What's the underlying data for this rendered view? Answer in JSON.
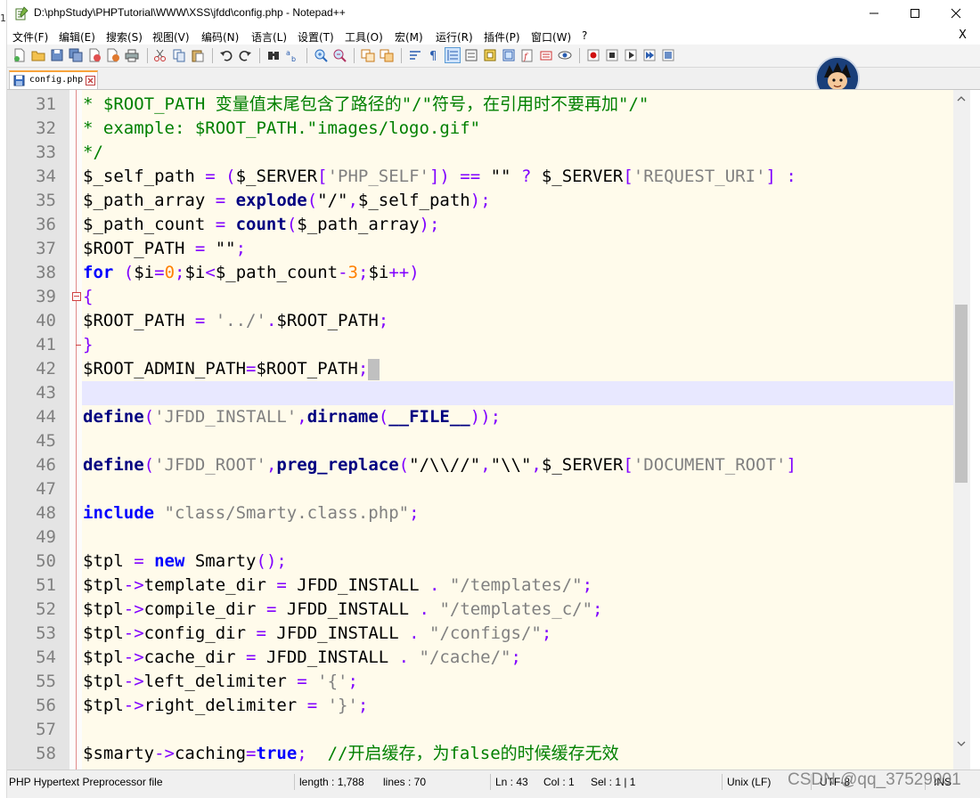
{
  "window": {
    "left_partial_text": "1",
    "title": "D:\\phpStudy\\PHPTutorial\\WWW\\XSS\\jfdd\\config.php - Notepad++",
    "controls": {
      "minimize": "minimize",
      "maximize": "maximize",
      "close": "close"
    }
  },
  "menu": {
    "items": [
      {
        "label": "文件(F)"
      },
      {
        "label": "编辑(E)"
      },
      {
        "label": "搜索(S)"
      },
      {
        "label": "视图(V)"
      },
      {
        "label": "编码(N)"
      },
      {
        "label": "语言(L)"
      },
      {
        "label": "设置(T)"
      },
      {
        "label": "工具(O)"
      },
      {
        "label": "宏(M)"
      },
      {
        "label": "运行(R)"
      },
      {
        "label": "插件(P)"
      },
      {
        "label": "窗口(W)"
      },
      {
        "label": "?"
      }
    ],
    "close_label": "X"
  },
  "tabs": [
    {
      "label": "config.php",
      "active": true
    }
  ],
  "editor": {
    "current_line": 43,
    "lines": [
      {
        "num": "31",
        "segs": [
          {
            "t": "* $ROOT_PATH 变量值末尾包含了路径的\"/\"符号，在引用时不要再加\"/\"",
            "c": "cm"
          }
        ]
      },
      {
        "num": "32",
        "segs": [
          {
            "t": "* example: $ROOT_PATH.\"images/logo.gif\"",
            "c": "cm"
          }
        ]
      },
      {
        "num": "33",
        "segs": [
          {
            "t": "*/",
            "c": "cm"
          }
        ]
      },
      {
        "num": "34",
        "segs": [
          {
            "t": "$_self_path ",
            "c": ""
          },
          {
            "t": "= (",
            "c": "op"
          },
          {
            "t": "$_SERVER",
            "c": ""
          },
          {
            "t": "[",
            "c": "op"
          },
          {
            "t": "'PHP_SELF'",
            "c": "s"
          },
          {
            "t": "]) == ",
            "c": "op"
          },
          {
            "t": "\"\"",
            "c": ""
          },
          {
            "t": " ? ",
            "c": "op"
          },
          {
            "t": "$_SERVER",
            "c": ""
          },
          {
            "t": "[",
            "c": "op"
          },
          {
            "t": "'REQUEST_URI'",
            "c": "s"
          },
          {
            "t": "] :",
            "c": "op"
          }
        ]
      },
      {
        "num": "35",
        "segs": [
          {
            "t": "$_path_array ",
            "c": ""
          },
          {
            "t": "= ",
            "c": "op"
          },
          {
            "t": "explode",
            "c": "f"
          },
          {
            "t": "(",
            "c": "op"
          },
          {
            "t": "\"/\"",
            "c": ""
          },
          {
            "t": ",",
            "c": "op"
          },
          {
            "t": "$_self_path",
            "c": ""
          },
          {
            "t": ");",
            "c": "op"
          }
        ]
      },
      {
        "num": "36",
        "segs": [
          {
            "t": "$_path_count ",
            "c": ""
          },
          {
            "t": "= ",
            "c": "op"
          },
          {
            "t": "count",
            "c": "f"
          },
          {
            "t": "(",
            "c": "op"
          },
          {
            "t": "$_path_array",
            "c": ""
          },
          {
            "t": ");",
            "c": "op"
          }
        ]
      },
      {
        "num": "37",
        "segs": [
          {
            "t": "$ROOT_PATH ",
            "c": ""
          },
          {
            "t": "= ",
            "c": "op"
          },
          {
            "t": "\"\"",
            "c": ""
          },
          {
            "t": ";",
            "c": "op"
          }
        ]
      },
      {
        "num": "38",
        "segs": [
          {
            "t": "for",
            "c": "k"
          },
          {
            "t": " (",
            "c": "op"
          },
          {
            "t": "$i",
            "c": ""
          },
          {
            "t": "=",
            "c": "op"
          },
          {
            "t": "0",
            "c": "n"
          },
          {
            "t": ";",
            "c": "op"
          },
          {
            "t": "$i",
            "c": ""
          },
          {
            "t": "<",
            "c": "op"
          },
          {
            "t": "$_path_count",
            "c": ""
          },
          {
            "t": "-",
            "c": "op"
          },
          {
            "t": "3",
            "c": "n"
          },
          {
            "t": ";",
            "c": "op"
          },
          {
            "t": "$i",
            "c": ""
          },
          {
            "t": "++)",
            "c": "op"
          }
        ]
      },
      {
        "num": "39",
        "fold": "box",
        "segs": [
          {
            "t": "{",
            "c": "op"
          }
        ]
      },
      {
        "num": "40",
        "fold": "mid",
        "segs": [
          {
            "t": "$ROOT_PATH ",
            "c": ""
          },
          {
            "t": "= ",
            "c": "op"
          },
          {
            "t": "'../'",
            "c": "s"
          },
          {
            "t": ".",
            "c": "op"
          },
          {
            "t": "$ROOT_PATH",
            "c": ""
          },
          {
            "t": ";",
            "c": "op"
          }
        ]
      },
      {
        "num": "41",
        "fold": "end",
        "segs": [
          {
            "t": "}",
            "c": "op"
          }
        ]
      },
      {
        "num": "42",
        "caret": true,
        "segs": [
          {
            "t": "$ROOT_ADMIN_PATH",
            "c": ""
          },
          {
            "t": "=",
            "c": "op"
          },
          {
            "t": "$ROOT_PATH",
            "c": ""
          },
          {
            "t": ";",
            "c": "op"
          }
        ]
      },
      {
        "num": "43",
        "segs": []
      },
      {
        "num": "44",
        "segs": [
          {
            "t": "define",
            "c": "f"
          },
          {
            "t": "(",
            "c": "op"
          },
          {
            "t": "'JFDD_INSTALL'",
            "c": "s"
          },
          {
            "t": ",",
            "c": "op"
          },
          {
            "t": "dirname",
            "c": "f"
          },
          {
            "t": "(",
            "c": "op"
          },
          {
            "t": "__FILE__",
            "c": "f"
          },
          {
            "t": "));",
            "c": "op"
          }
        ]
      },
      {
        "num": "45",
        "segs": []
      },
      {
        "num": "46",
        "segs": [
          {
            "t": "define",
            "c": "f"
          },
          {
            "t": "(",
            "c": "op"
          },
          {
            "t": "'JFDD_ROOT'",
            "c": "s"
          },
          {
            "t": ",",
            "c": "op"
          },
          {
            "t": "preg_replace",
            "c": "f"
          },
          {
            "t": "(",
            "c": "op"
          },
          {
            "t": "\"/\\\\//\"",
            "c": ""
          },
          {
            "t": ",",
            "c": "op"
          },
          {
            "t": "\"\\\\\"",
            "c": ""
          },
          {
            "t": ",",
            "c": "op"
          },
          {
            "t": "$_SERVER",
            "c": ""
          },
          {
            "t": "[",
            "c": "op"
          },
          {
            "t": "'DOCUMENT_ROOT'",
            "c": "s"
          },
          {
            "t": "]",
            "c": "op"
          }
        ]
      },
      {
        "num": "47",
        "segs": []
      },
      {
        "num": "48",
        "segs": [
          {
            "t": "include",
            "c": "k"
          },
          {
            "t": " ",
            "c": ""
          },
          {
            "t": "\"class/Smarty.class.php\"",
            "c": "s"
          },
          {
            "t": ";",
            "c": "op"
          }
        ]
      },
      {
        "num": "49",
        "segs": []
      },
      {
        "num": "50",
        "segs": [
          {
            "t": "$tpl ",
            "c": ""
          },
          {
            "t": "= ",
            "c": "op"
          },
          {
            "t": "new",
            "c": "k"
          },
          {
            "t": " Smarty",
            "c": ""
          },
          {
            "t": "();",
            "c": "op"
          }
        ]
      },
      {
        "num": "51",
        "segs": [
          {
            "t": "$tpl",
            "c": ""
          },
          {
            "t": "->",
            "c": "op"
          },
          {
            "t": "template_dir ",
            "c": ""
          },
          {
            "t": "= ",
            "c": "op"
          },
          {
            "t": "JFDD_INSTALL ",
            "c": ""
          },
          {
            "t": ". ",
            "c": "op"
          },
          {
            "t": "\"/templates/\"",
            "c": "s"
          },
          {
            "t": ";",
            "c": "op"
          }
        ]
      },
      {
        "num": "52",
        "segs": [
          {
            "t": "$tpl",
            "c": ""
          },
          {
            "t": "->",
            "c": "op"
          },
          {
            "t": "compile_dir ",
            "c": ""
          },
          {
            "t": "= ",
            "c": "op"
          },
          {
            "t": "JFDD_INSTALL ",
            "c": ""
          },
          {
            "t": ". ",
            "c": "op"
          },
          {
            "t": "\"/templates_c/\"",
            "c": "s"
          },
          {
            "t": ";",
            "c": "op"
          }
        ]
      },
      {
        "num": "53",
        "segs": [
          {
            "t": "$tpl",
            "c": ""
          },
          {
            "t": "->",
            "c": "op"
          },
          {
            "t": "config_dir ",
            "c": ""
          },
          {
            "t": "= ",
            "c": "op"
          },
          {
            "t": "JFDD_INSTALL ",
            "c": ""
          },
          {
            "t": ". ",
            "c": "op"
          },
          {
            "t": "\"/configs/\"",
            "c": "s"
          },
          {
            "t": ";",
            "c": "op"
          }
        ]
      },
      {
        "num": "54",
        "segs": [
          {
            "t": "$tpl",
            "c": ""
          },
          {
            "t": "->",
            "c": "op"
          },
          {
            "t": "cache_dir ",
            "c": ""
          },
          {
            "t": "= ",
            "c": "op"
          },
          {
            "t": "JFDD_INSTALL ",
            "c": ""
          },
          {
            "t": ". ",
            "c": "op"
          },
          {
            "t": "\"/cache/\"",
            "c": "s"
          },
          {
            "t": ";",
            "c": "op"
          }
        ]
      },
      {
        "num": "55",
        "segs": [
          {
            "t": "$tpl",
            "c": ""
          },
          {
            "t": "->",
            "c": "op"
          },
          {
            "t": "left_delimiter ",
            "c": ""
          },
          {
            "t": "= ",
            "c": "op"
          },
          {
            "t": "'{'",
            "c": "s"
          },
          {
            "t": ";",
            "c": "op"
          }
        ]
      },
      {
        "num": "56",
        "segs": [
          {
            "t": "$tpl",
            "c": ""
          },
          {
            "t": "->",
            "c": "op"
          },
          {
            "t": "right_delimiter ",
            "c": ""
          },
          {
            "t": "= ",
            "c": "op"
          },
          {
            "t": "'}'",
            "c": "s"
          },
          {
            "t": ";",
            "c": "op"
          }
        ]
      },
      {
        "num": "57",
        "segs": []
      },
      {
        "num": "58",
        "segs": [
          {
            "t": "$smarty",
            "c": ""
          },
          {
            "t": "->",
            "c": "op"
          },
          {
            "t": "caching",
            "c": ""
          },
          {
            "t": "=",
            "c": "op"
          },
          {
            "t": "true",
            "c": "k"
          },
          {
            "t": ";  ",
            "c": "op"
          },
          {
            "t": "//开启缓存，为false的时候缓存无效",
            "c": "cm"
          }
        ]
      }
    ]
  },
  "status": {
    "file_type": "PHP Hypertext Preprocessor file",
    "length": "length : 1,788",
    "lines": "lines : 70",
    "ln": "Ln : 43",
    "col": "Col : 1",
    "sel": "Sel : 1 | 1",
    "eol": "Unix (LF)",
    "encoding": "UTF-8",
    "mode": "INS",
    "watermark": "CSDN @qq_37529901"
  },
  "colors": {
    "editor_bg": "#fffbeb",
    "current_line": "#e8e8ff",
    "keyword": "#0000ff",
    "function": "#000080",
    "string": "#808080",
    "comment": "#008000",
    "number": "#ff8000",
    "operator": "#8000ff",
    "tab_accent": "#f8a33b"
  }
}
